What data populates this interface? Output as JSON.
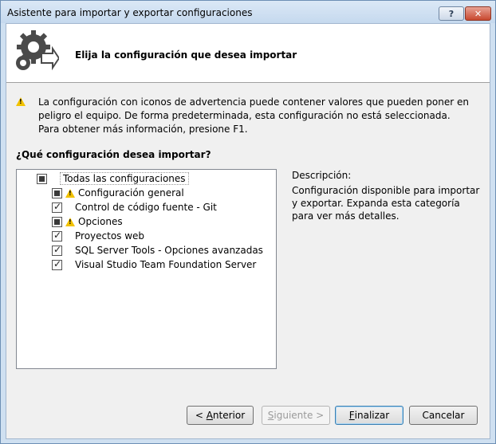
{
  "window": {
    "title": "Asistente para importar y exportar configuraciones",
    "help_label": "?",
    "close_label": "✕"
  },
  "header": {
    "title": "Elija la configuración que desea importar"
  },
  "warning": {
    "text": "La configuración con iconos de advertencia puede contener valores que pueden poner en peligro el equipo. De forma predeterminada, esta configuración no está seleccionada. Para obtener más información, presione F1."
  },
  "question": "¿Qué configuración desea importar?",
  "tree": {
    "root": {
      "label": "Todas las configuraciones",
      "state": "partial"
    },
    "items": [
      {
        "label": "Configuración general",
        "state": "partial",
        "warning": true
      },
      {
        "label": "Control de código fuente - Git",
        "state": "checked",
        "warning": false
      },
      {
        "label": "Opciones",
        "state": "partial",
        "warning": true
      },
      {
        "label": "Proyectos web",
        "state": "checked",
        "warning": false
      },
      {
        "label": "SQL Server Tools - Opciones avanzadas",
        "state": "checked",
        "warning": false
      },
      {
        "label": "Visual Studio Team Foundation Server",
        "state": "checked",
        "warning": false
      }
    ]
  },
  "description": {
    "title": "Descripción:",
    "text": "Configuración disponible para importar y exportar. Expanda esta categoría para ver más detalles."
  },
  "buttons": {
    "back_prefix": "< ",
    "back_mnemonic": "A",
    "back_rest": "nterior",
    "next_mnemonic": "S",
    "next_rest": "iguiente >",
    "finish_mnemonic": "F",
    "finish_rest": "inalizar",
    "cancel": "Cancelar"
  },
  "colors": {
    "title_bar": "#c5d9ee",
    "warning_icon": "#f2c200",
    "close_button": "#c8482f"
  }
}
